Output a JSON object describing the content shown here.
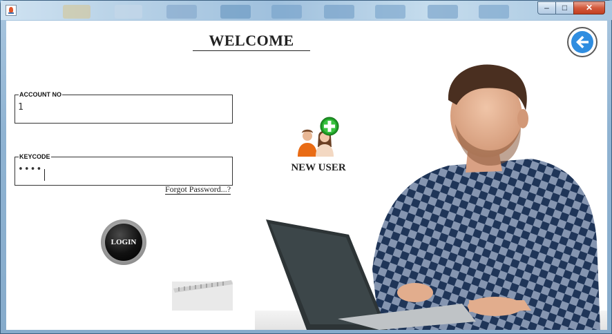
{
  "window": {
    "minimize_glyph": "–",
    "maximize_glyph": "□",
    "close_glyph": "✕"
  },
  "header": {
    "title": "WELCOME"
  },
  "form": {
    "account": {
      "label": "ACCOUNT NO",
      "value": "1"
    },
    "keycode": {
      "label": "KEYCODE",
      "value": "••••"
    },
    "forgot_label": "Forgot Password...?",
    "login_label": "LOGIN"
  },
  "new_user": {
    "label": "NEW USER"
  },
  "icons": {
    "app": "java-app-icon",
    "back": "back-arrow-icon",
    "new_user": "add-user-icon"
  },
  "colors": {
    "back_button": "#2f8de0",
    "add_badge": "#22a82a",
    "login_button": "#111111",
    "close_button": "#c9472a"
  }
}
